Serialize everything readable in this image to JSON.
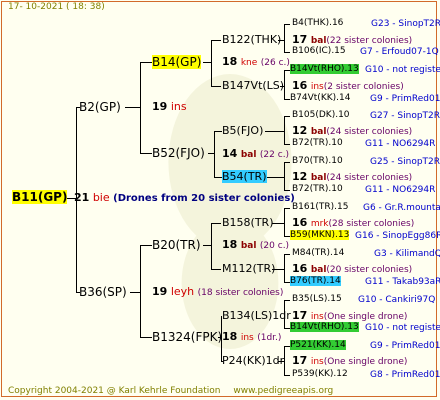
{
  "header": "17- 10-2021 ( 18: 38)",
  "footer": {
    "copyright": "Copyright 2004-2021 @ Karl Kehrle Foundation",
    "url": "www.pedigreeapis.org"
  },
  "root": {
    "name": "B11(GP)",
    "num": "21",
    "abbr": "bie",
    "note": "(Drones from 20 sister colonies)"
  },
  "g2": {
    "top": {
      "name": "B2(GP)",
      "num": "19",
      "abbr": "ins"
    },
    "bottom": {
      "name": "B36(SP)",
      "num": "19",
      "abbr": "leyh",
      "extra": "(18 sister colonies)"
    }
  },
  "g3": [
    {
      "name": "B14(GP)",
      "num": "18",
      "abbr": "kne",
      "extra": "(26 c.)"
    },
    {
      "name": "B52(FJO)",
      "num": "14",
      "abbr": "bal",
      "extra": "(22 c.)"
    },
    {
      "name": "B20(TR)",
      "num": "18",
      "abbr": "bal",
      "extra": "(20 c.)"
    },
    {
      "name": "B1324(FPK)",
      "num": "18",
      "abbr": "ins",
      "extra": "(1dr.)"
    }
  ],
  "g4": [
    {
      "name": "B122(THK)",
      "num": "17",
      "abbr": "bal",
      "extra": "(22 sister colonies)"
    },
    {
      "name": "B147Vt(LS)",
      "num": "16",
      "abbr": "ins",
      "extra": "(2 sister colonies)"
    },
    {
      "name": "B5(FJO)",
      "num": "12",
      "abbr": "bal",
      "extra": "(24 sister colonies)"
    },
    {
      "name": "B54(TR)",
      "num": "12",
      "abbr": "bal",
      "extra": "(24 sister colonies)"
    },
    {
      "name": "B158(TR)",
      "num": "16",
      "abbr": "mrk",
      "extra": "(28 sister colonies)"
    },
    {
      "name": "M112(TR)",
      "num": "16",
      "abbr": "bal",
      "extra": "(20 sister colonies)"
    },
    {
      "name": "B134(LS)1dr",
      "num": "17",
      "abbr": "ins",
      "extra": "(One single drone)"
    },
    {
      "name": "P24(KK)1dr",
      "num": "17",
      "abbr": "ins",
      "extra": "(One single drone)"
    }
  ],
  "g5": [
    {
      "name": "B4(THK).16",
      "code": "G23 - SinopT2R"
    },
    {
      "name": "B106(IC).15",
      "code": "G7 - Erfoud07-1Q"
    },
    {
      "name": "B14Vt(RHO).13",
      "code": "G10 - not registe"
    },
    {
      "name": "B74Vt(KK).14",
      "code": "G9 - PrimRed01"
    },
    {
      "name": "B105(DK).10",
      "code": "G27 - SinopT2R"
    },
    {
      "name": "B72(TR).10",
      "code": "G11 - NO6294R"
    },
    {
      "name": "B70(TR).10",
      "code": "G25 - SinopT2R"
    },
    {
      "name": "B72(TR).10",
      "code": "G11 - NO6294R"
    },
    {
      "name": "B161(TR).15",
      "code": "G6 - Gr.R.mounta"
    },
    {
      "name": "B59(MKN).13",
      "code": "G16 - SinopEgg86R"
    },
    {
      "name": "M84(TR).14",
      "code": "G3 - KilimandQ"
    },
    {
      "name": "B76(TR).14",
      "code": "G11 - Takab93aR"
    },
    {
      "name": "B35(LS).15",
      "code": "G10 - Cankiri97Q"
    },
    {
      "name": "B14Vt(RHO).13",
      "code": "G10 - not registe"
    },
    {
      "name": "P521(KK).14",
      "code": "G9 - PrimRed01"
    },
    {
      "name": "P539(KK).12",
      "code": "G8 - PrimRed01"
    }
  ],
  "colors": {
    "border": "#d26a2a",
    "yellow": "#ffff00",
    "green": "#33cc33",
    "cyan": "#33ccff",
    "red": "#d00000",
    "code": "#0000cc"
  }
}
